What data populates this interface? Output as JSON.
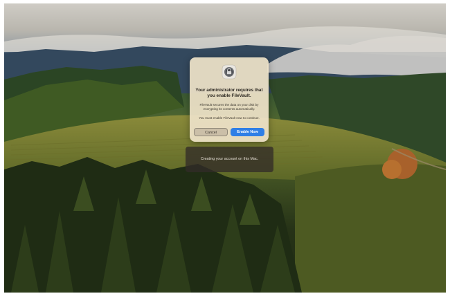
{
  "wallpaper": {
    "description": "macOS Sonoma hills wallpaper"
  },
  "dialog": {
    "icon": "filevault-lock-icon",
    "title": "Your administrator requires that you enable FileVault.",
    "body": "FileVault secures the data on your disk by encrypting its contents automatically.",
    "requirement": "You must enable FileVault now to continue.",
    "cancel_label": "Cancel",
    "enable_label": "Enable Now",
    "accent_color": "#2f7fe6"
  },
  "status": {
    "message": "Creating your account on this Mac."
  }
}
